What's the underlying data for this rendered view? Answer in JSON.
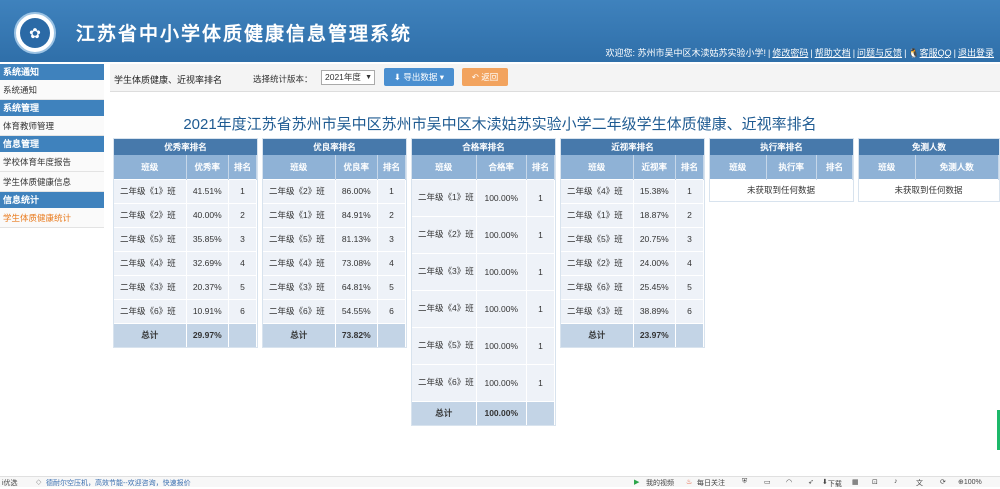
{
  "header": {
    "app_title": "江苏省中小学体质健康信息管理系统",
    "welcome": "欢迎您: 苏州市吴中区木渎姑苏实验小学!",
    "links": [
      "修改密码",
      "帮助文档",
      "问题与反馈",
      "客服QQ",
      "退出登录"
    ]
  },
  "sidebar": {
    "groups": [
      {
        "title": "系统通知",
        "items": [
          {
            "label": "系统通知"
          }
        ]
      },
      {
        "title": "系统管理",
        "items": [
          {
            "label": "体育教师管理"
          }
        ]
      },
      {
        "title": "信息管理",
        "items": [
          {
            "label": "学校体育年度报告"
          },
          {
            "label": "学生体质健康信息"
          }
        ]
      },
      {
        "title": "信息统计",
        "items": [
          {
            "label": "学生体质健康统计",
            "active": true
          }
        ]
      }
    ]
  },
  "toolbar": {
    "title": "学生体质健康、近视率排名",
    "version_label": "选择统计版本：",
    "version_value": "2021年度",
    "export_label": "导出数据",
    "back_label": "返回"
  },
  "page_heading": "2021年度江苏省苏州市吴中区苏州市吴中区木渎姑苏实验小学二年级学生体质健康、近视率排名",
  "panels": [
    {
      "title": "优秀率排名",
      "headers": [
        "班级",
        "优秀率",
        "排名"
      ],
      "rows": [
        [
          "二年级《1》班",
          "41.51%",
          "1"
        ],
        [
          "二年级《2》班",
          "40.00%",
          "2"
        ],
        [
          "二年级《5》班",
          "35.85%",
          "3"
        ],
        [
          "二年级《4》班",
          "32.69%",
          "4"
        ],
        [
          "二年级《3》班",
          "20.37%",
          "5"
        ],
        [
          "二年级《6》班",
          "10.91%",
          "6"
        ]
      ],
      "total_label": "总计",
      "total_value": "29.97%"
    },
    {
      "title": "优良率排名",
      "headers": [
        "班级",
        "优良率",
        "排名"
      ],
      "rows": [
        [
          "二年级《2》班",
          "86.00%",
          "1"
        ],
        [
          "二年级《1》班",
          "84.91%",
          "2"
        ],
        [
          "二年级《5》班",
          "81.13%",
          "3"
        ],
        [
          "二年级《4》班",
          "73.08%",
          "4"
        ],
        [
          "二年级《3》班",
          "64.81%",
          "5"
        ],
        [
          "二年级《6》班",
          "54.55%",
          "6"
        ]
      ],
      "total_label": "总计",
      "total_value": "73.82%"
    },
    {
      "title": "合格率排名",
      "headers": [
        "班级",
        "合格率",
        "排名"
      ],
      "rows": [
        [
          "二年级《1》班",
          "100.00%",
          "1"
        ],
        [
          "二年级《2》班",
          "100.00%",
          "1"
        ],
        [
          "二年级《3》班",
          "100.00%",
          "1"
        ],
        [
          "二年级《4》班",
          "100.00%",
          "1"
        ],
        [
          "二年级《5》班",
          "100.00%",
          "1"
        ],
        [
          "二年级《6》班",
          "100.00%",
          "1"
        ]
      ],
      "total_label": "总计",
      "total_value": "100.00%"
    },
    {
      "title": "近视率排名",
      "headers": [
        "班级",
        "近视率",
        "排名"
      ],
      "rows": [
        [
          "二年级《4》班",
          "15.38%",
          "1"
        ],
        [
          "二年级《1》班",
          "18.87%",
          "2"
        ],
        [
          "二年级《5》班",
          "20.75%",
          "3"
        ],
        [
          "二年级《2》班",
          "24.00%",
          "4"
        ],
        [
          "二年级《6》班",
          "25.45%",
          "5"
        ],
        [
          "二年级《3》班",
          "38.89%",
          "6"
        ]
      ],
      "total_label": "总计",
      "total_value": "23.97%"
    },
    {
      "title": "执行率排名",
      "headers": [
        "班级",
        "执行率",
        "排名"
      ],
      "empty_text": "未获取到任何数据"
    },
    {
      "title": "免测人数",
      "headers": [
        "班级",
        "免测人数"
      ],
      "empty_text": "未获取到任何数据"
    }
  ],
  "statusbar": {
    "left": "i优选",
    "ad": "德耐尔空压机，高效节能--欢迎咨询，快速报价",
    "video": "我的视频",
    "daily": "每日关注",
    "download": "下载",
    "zoom": "100%"
  },
  "colors": {
    "header_bg": "#3f82bd",
    "panel_title": "#4779ab",
    "panel_header": "#8fb2d6",
    "export_btn": "#4a8fd0",
    "back_btn": "#f2a35e",
    "active_menu": "#e97b1e"
  }
}
